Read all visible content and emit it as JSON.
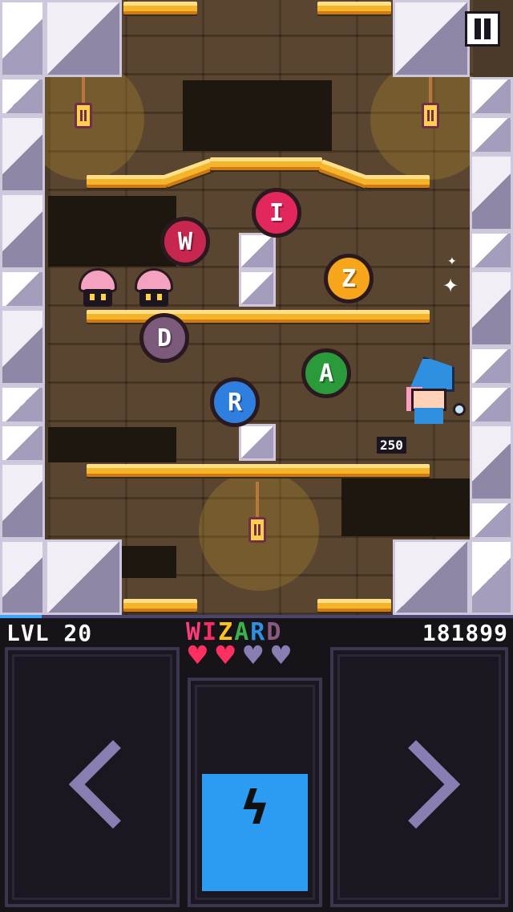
{
  "hud": {
    "level": "LVL 20",
    "score": "181899",
    "word_letters": [
      {
        "char": "W",
        "color": "#ff3d79"
      },
      {
        "char": "I",
        "color": "#ff2a63"
      },
      {
        "char": "Z",
        "color": "#ffc21a"
      },
      {
        "char": "A",
        "color": "#38b24a"
      },
      {
        "char": "R",
        "color": "#2f8fe0"
      },
      {
        "char": "D",
        "color": "#8a5a83"
      }
    ],
    "hearts_full": 2,
    "hearts_total": 4,
    "heart_full_color": "#ff2f5f",
    "heart_empty_color": "#8a7db1",
    "energy_level": 0.6
  },
  "game": {
    "score_popup": "250",
    "letter_bubbles": [
      {
        "char": "W",
        "color": "#c7264e"
      },
      {
        "char": "I",
        "color": "#e3265c"
      },
      {
        "char": "Z",
        "color": "#f7a51a"
      },
      {
        "char": "D",
        "color": "#7b5a7c"
      },
      {
        "char": "A",
        "color": "#2a9a3a"
      },
      {
        "char": "R",
        "color": "#2f7fe0"
      }
    ]
  },
  "controls": {
    "left_icon": "chevron-left-icon",
    "action_icon": "lightning-icon",
    "right_icon": "chevron-right-icon",
    "pause_icon": "pause-icon"
  }
}
